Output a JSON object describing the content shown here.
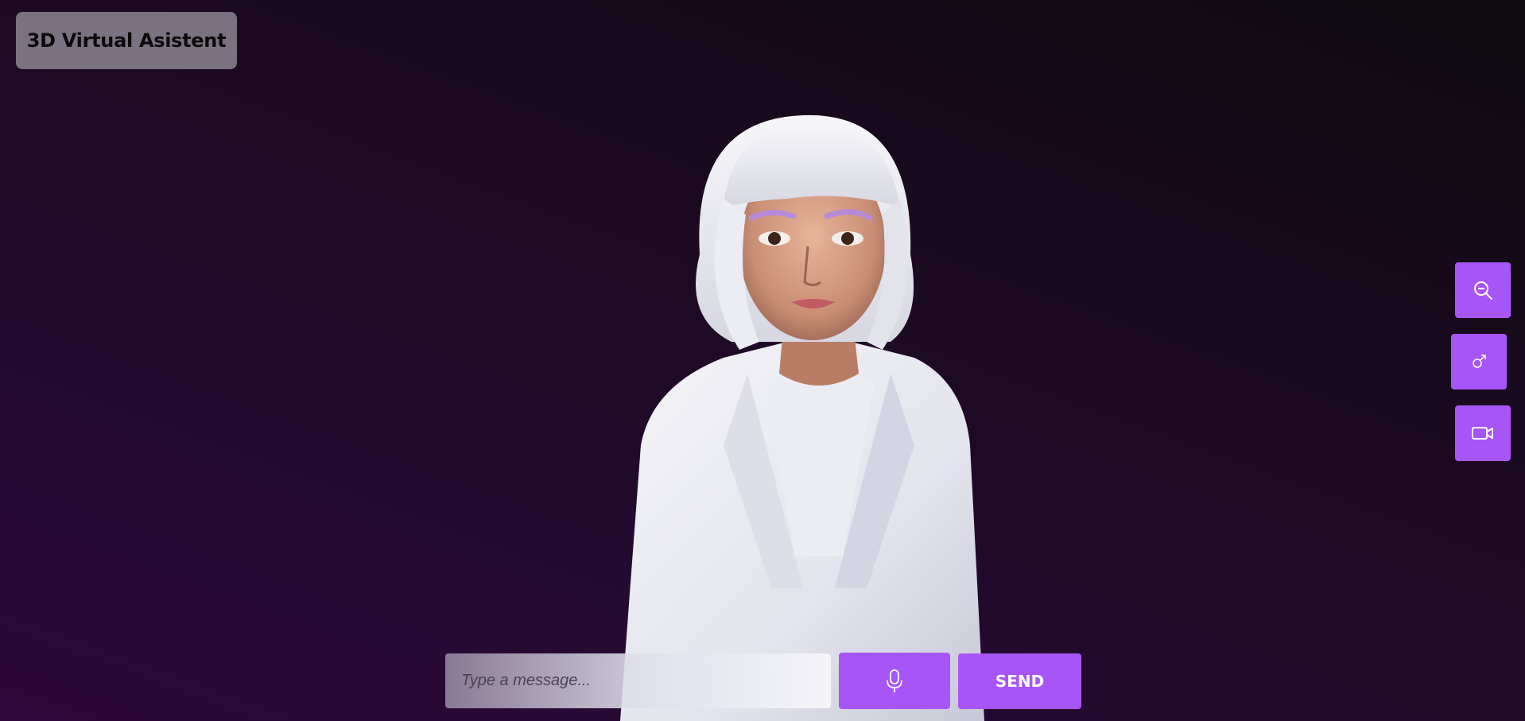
{
  "app": {
    "title": "3D Virtual Asistent"
  },
  "side_controls": {
    "zoom_icon": "zoom-out-icon",
    "gender_icon": "male-symbol-icon",
    "camera_icon": "video-camera-icon"
  },
  "chat": {
    "input_placeholder": "Type a message...",
    "input_value": "",
    "mic_icon": "microphone-icon",
    "send_label": "SEND"
  },
  "colors": {
    "accent": "#a855f7",
    "background_top": "#0e0a0f",
    "background_bottom": "#2e0838",
    "badge_bg": "#c8c8cd"
  }
}
